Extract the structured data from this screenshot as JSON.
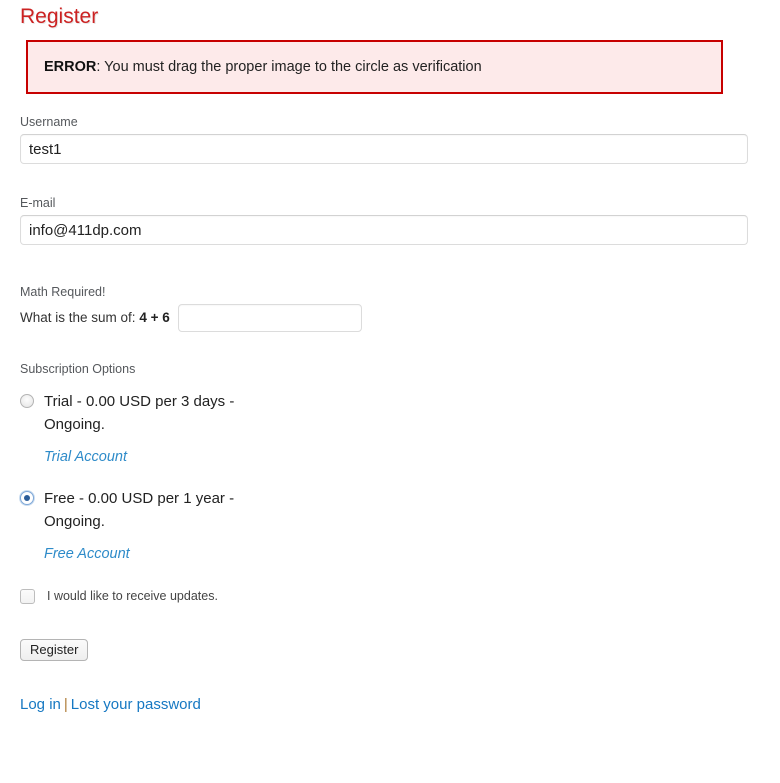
{
  "page": {
    "title": "Register"
  },
  "error": {
    "label": "ERROR",
    "separator": ": ",
    "message": "You must drag the proper image to the circle as verification"
  },
  "fields": {
    "username": {
      "label": "Username",
      "value": "test1",
      "placeholder": ""
    },
    "email": {
      "label": "E-mail",
      "value": "info@411dp.com",
      "placeholder": ""
    }
  },
  "math": {
    "heading": "Math Required!",
    "question_prefix": "What is the sum of:",
    "sum": "4 + 6",
    "value": "",
    "placeholder": ""
  },
  "subscription": {
    "heading": "Subscription Options",
    "options": [
      {
        "label": "Trial - 0.00 USD per 3 days - Ongoing.",
        "link": "Trial Account",
        "selected": false
      },
      {
        "label": "Free - 0.00 USD per 1 year - Ongoing.",
        "link": "Free Account",
        "selected": true
      }
    ]
  },
  "updates": {
    "label": "I would like to receive updates.",
    "checked": false
  },
  "submit": {
    "label": "Register"
  },
  "footer": {
    "login": "Log in",
    "separator": "|",
    "lost_password": "Lost your password"
  },
  "colors": {
    "title": "#cc2222",
    "error_border": "#c70000",
    "error_background": "#fdeaea",
    "link": "#1678c2",
    "option_link": "#2e8bc9",
    "radio_selected": "#2c5d99"
  }
}
